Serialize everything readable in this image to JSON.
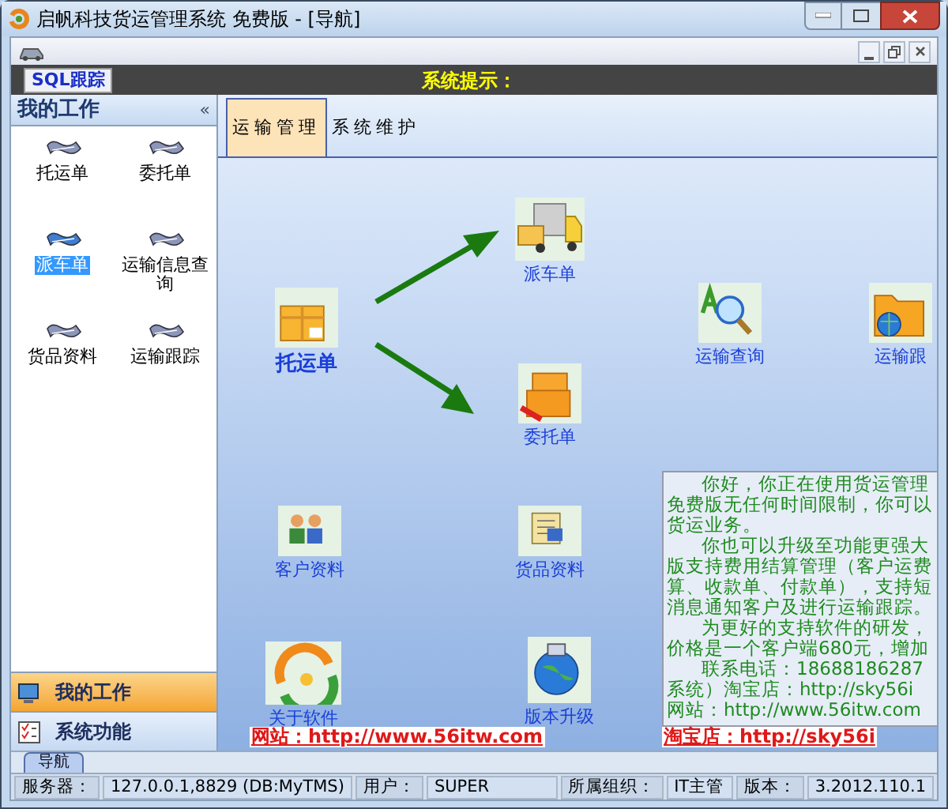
{
  "window": {
    "title": "启帆科技货运管理系统 免费版 - [导航]"
  },
  "sql_button": "SQL跟踪",
  "notice_title": "系统提示：",
  "sidebar": {
    "title": "我的工作",
    "collapse": "«",
    "items": [
      {
        "label": "托运单",
        "selected": false
      },
      {
        "label": "委托单",
        "selected": false
      },
      {
        "label": "派车单",
        "selected": true
      },
      {
        "label": "运输信息查询",
        "selected": false
      },
      {
        "label": "货品资料",
        "selected": false
      },
      {
        "label": "运输跟踪",
        "selected": false
      }
    ],
    "nav_buttons": [
      {
        "label": "我的工作",
        "selected": true
      },
      {
        "label": "系统功能",
        "selected": false
      }
    ]
  },
  "tabs": [
    {
      "label": "运输管理",
      "selected": true
    },
    {
      "label": "系统维护",
      "selected": false
    }
  ],
  "canvas": {
    "nodes": [
      {
        "label": "托运单"
      },
      {
        "label": "派车单"
      },
      {
        "label": "委托单"
      },
      {
        "label": "运输查询"
      },
      {
        "label": "运输跟"
      },
      {
        "label": "客户资料"
      },
      {
        "label": "货品资料"
      },
      {
        "label": "关于软件"
      },
      {
        "label": "版本升级"
      }
    ],
    "notice_paragraphs": [
      [
        "你好，你正在使用货运管理",
        "免费版无任何时间限制，你可以",
        "货运业务。"
      ],
      [
        "你也可以升级至功能更强大",
        "版支持费用结算管理（客户运费",
        "算、收款单、付款单），支持短",
        "消息通知客户及进行运输跟踪。"
      ],
      [
        "为更好的支持软件的研发，",
        "价格是一个客户端680元，增加"
      ],
      [
        "联系电话：18688186287",
        "系统）淘宝店：http://sky56i",
        "网站：http://www.56itw.com"
      ]
    ],
    "links": [
      "网站：http://www.56itw.com",
      "淘宝店：http://sky56i"
    ]
  },
  "bottom_tab": "导航",
  "status_bar": [
    {
      "label": "服务器：",
      "value": "127.0.0.1,8829 (DB:MyTMS)"
    },
    {
      "label": "用户：",
      "value": "SUPER"
    },
    {
      "label": "所属组织：",
      "value": "IT主管"
    },
    {
      "label": "版本：",
      "value": "3.2012.110.1"
    }
  ]
}
